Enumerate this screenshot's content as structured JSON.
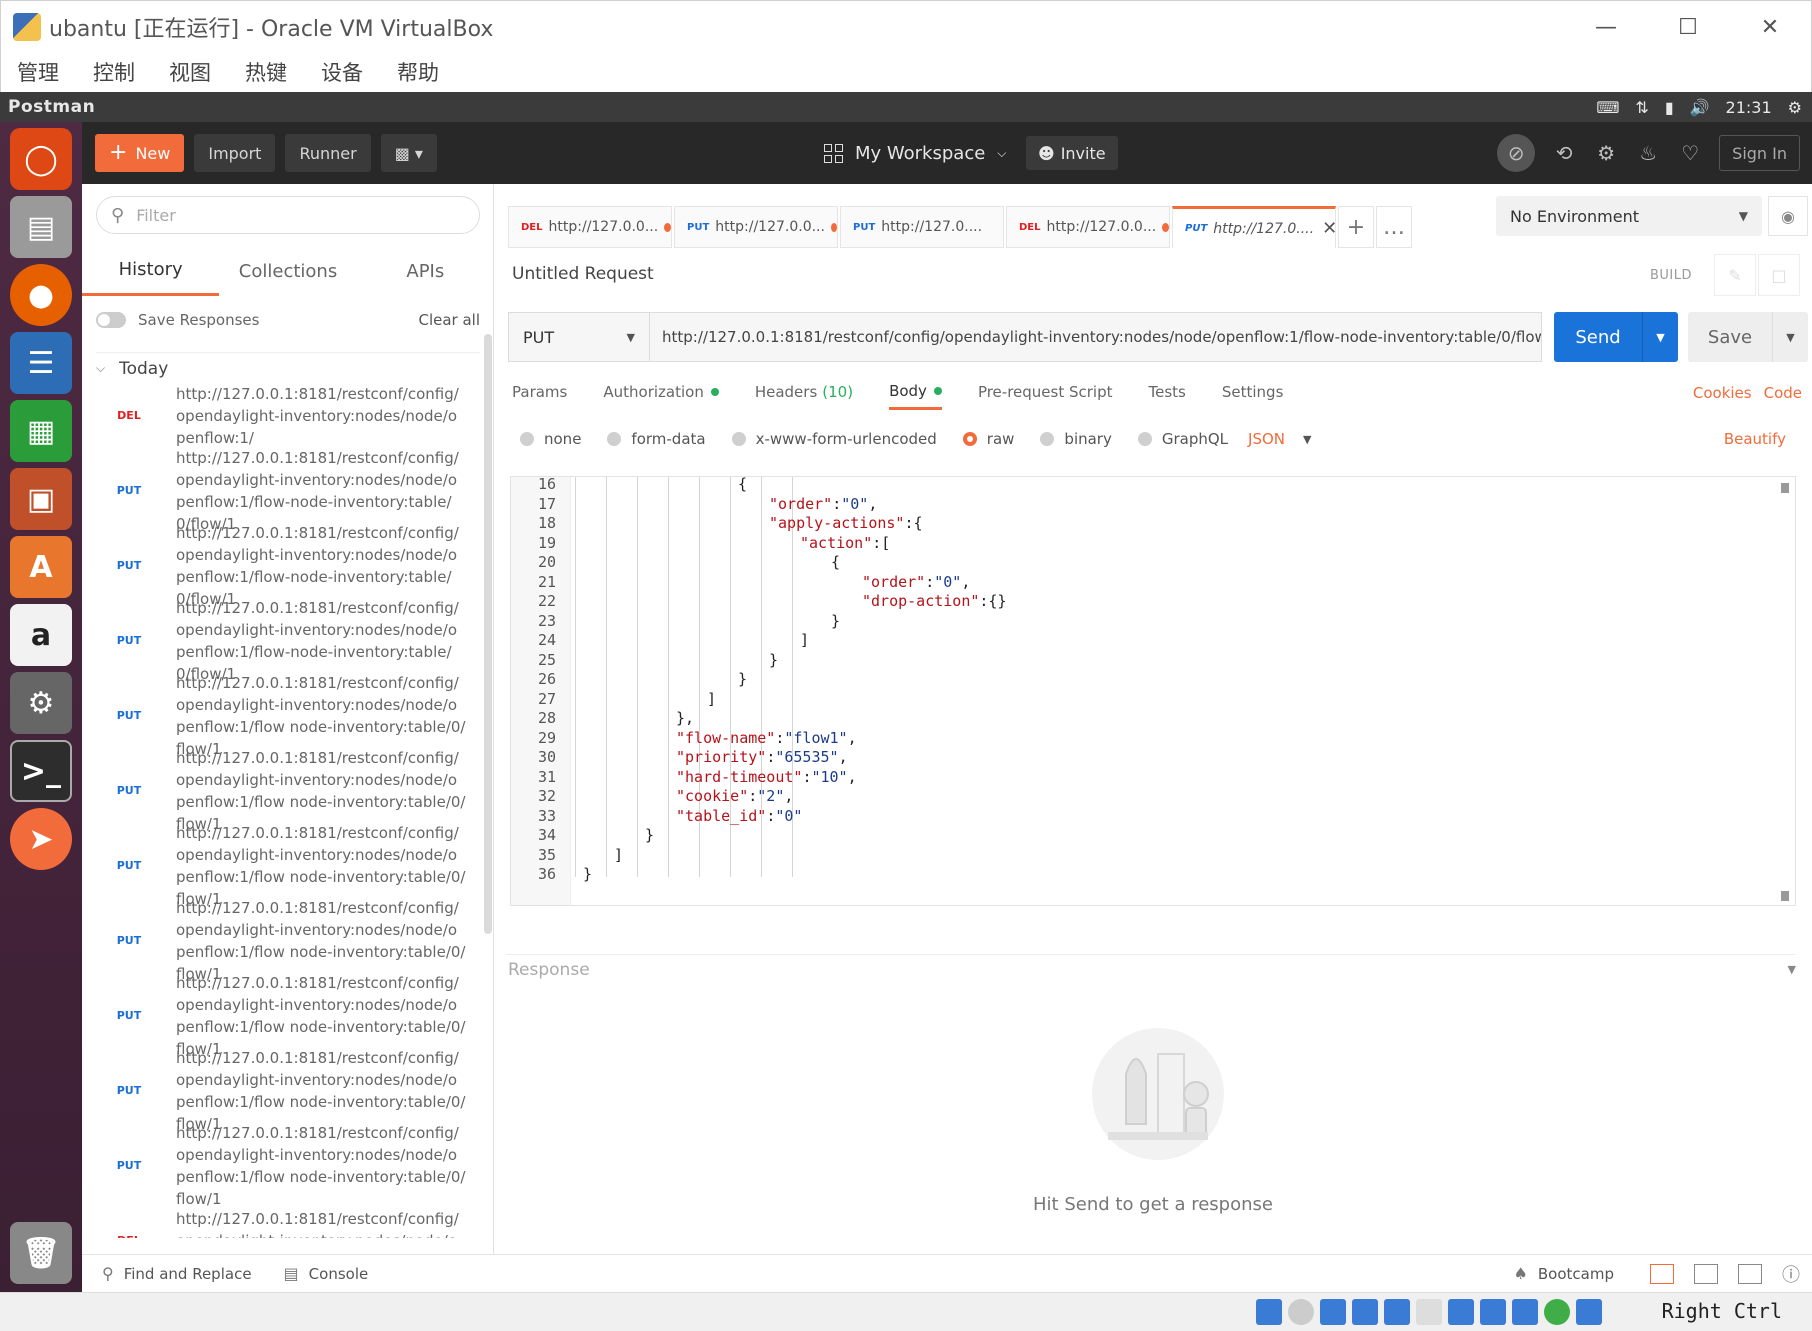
{
  "vbox": {
    "title": "ubantu [正在运行] - Oracle VM VirtualBox",
    "menu": [
      "管理",
      "控制",
      "视图",
      "热键",
      "设备",
      "帮助"
    ],
    "host_key": "Right Ctrl"
  },
  "ubuntu": {
    "app_name": "Postman",
    "clock": "21:31"
  },
  "header": {
    "new_label": "New",
    "import_label": "Import",
    "runner_label": "Runner",
    "workspace_label": "My Workspace",
    "invite_label": "Invite",
    "signin_label": "Sign In"
  },
  "sidebar": {
    "filter_placeholder": "Filter",
    "tabs": [
      "History",
      "Collections",
      "APIs"
    ],
    "save_responses_label": "Save Responses",
    "clear_all_label": "Clear all",
    "group_label": "Today",
    "history": [
      {
        "method": "DEL",
        "url": "http://127.0.0.1:8181/restconf/config/opendaylight-inventory:nodes/node/openflow:1/"
      },
      {
        "method": "PUT",
        "url": "http://127.0.0.1:8181/restconf/config/opendaylight-inventory:nodes/node/openflow:1/flow-node-inventory:table/0/flow/1"
      },
      {
        "method": "PUT",
        "url": "http://127.0.0.1:8181/restconf/config/opendaylight-inventory:nodes/node/openflow:1/flow-node-inventory:table/0/flow/1"
      },
      {
        "method": "PUT",
        "url": "http://127.0.0.1:8181/restconf/config/opendaylight-inventory:nodes/node/openflow:1/flow-node-inventory:table/0/flow/1"
      },
      {
        "method": "PUT",
        "url": "http://127.0.0.1:8181/restconf/config/opendaylight-inventory:nodes/node/openflow:1/flow node-inventory:table/0/flow/1"
      },
      {
        "method": "PUT",
        "url": "http://127.0.0.1:8181/restconf/config/opendaylight-inventory:nodes/node/openflow:1/flow node-inventory:table/0/flow/1"
      },
      {
        "method": "PUT",
        "url": "http://127.0.0.1:8181/restconf/config/opendaylight-inventory:nodes/node/openflow:1/flow node-inventory:table/0/flow/1"
      },
      {
        "method": "PUT",
        "url": "http://127.0.0.1:8181/restconf/config/opendaylight-inventory:nodes/node/openflow:1/flow node-inventory:table/0/flow/1"
      },
      {
        "method": "PUT",
        "url": "http://127.0.0.1:8181/restconf/config/opendaylight-inventory:nodes/node/openflow:1/flow node-inventory:table/0/flow/1"
      },
      {
        "method": "PUT",
        "url": "http://127.0.0.1:8181/restconf/config/opendaylight-inventory:nodes/node/openflow:1/flow node-inventory:table/0/flow/1"
      },
      {
        "method": "PUT",
        "url": "http://127.0.0.1:8181/restconf/config/opendaylight-inventory:nodes/node/openflow:1/flow node-inventory:table/0/flow/1"
      },
      {
        "method": "DEL",
        "url": "http://127.0.0.1:8181/restconf/config/opendaylight-inventory:nodes/node/openflo"
      }
    ]
  },
  "request_tabs": [
    {
      "method": "DEL",
      "label": "http://127.0.0...",
      "unsaved": true
    },
    {
      "method": "PUT",
      "label": "http://127.0.0...",
      "unsaved": true
    },
    {
      "method": "PUT",
      "label": "http://127.0....",
      "unsaved": false
    },
    {
      "method": "DEL",
      "label": "http://127.0.0...",
      "unsaved": true
    },
    {
      "method": "PUT",
      "label": "http://127.0....",
      "unsaved": false,
      "active": true
    }
  ],
  "environment": {
    "selected": "No Environment"
  },
  "request": {
    "name": "Untitled Request",
    "build_label": "BUILD",
    "method": "PUT",
    "url": "http://127.0.0.1:8181/restconf/config/opendaylight-inventory:nodes/node/openflow:1/flow-node-inventory:table/0/flow/1",
    "send_label": "Send",
    "save_label": "Save"
  },
  "sub_tabs": {
    "params": "Params",
    "authorization": "Authorization",
    "headers": "Headers",
    "headers_count": "(10)",
    "body": "Body",
    "pre_request": "Pre-request Script",
    "tests": "Tests",
    "settings": "Settings",
    "cookies": "Cookies",
    "code": "Code"
  },
  "body_types": {
    "options": [
      "none",
      "form-data",
      "x-www-form-urlencoded",
      "raw",
      "binary",
      "GraphQL"
    ],
    "selected": "raw",
    "format": "JSON",
    "beautify": "Beautify"
  },
  "code_lines": [
    {
      "n": "16",
      "indent": 5,
      "text": "{"
    },
    {
      "n": "17",
      "indent": 6,
      "text": "\"order\":\"0\","
    },
    {
      "n": "18",
      "indent": 6,
      "text": "\"apply-actions\":{"
    },
    {
      "n": "19",
      "indent": 7,
      "text": "\"action\":["
    },
    {
      "n": "20",
      "indent": 8,
      "text": "{"
    },
    {
      "n": "21",
      "indent": 9,
      "text": "\"order\":\"0\","
    },
    {
      "n": "22",
      "indent": 9,
      "text": "\"drop-action\":{}"
    },
    {
      "n": "23",
      "indent": 8,
      "text": "}"
    },
    {
      "n": "24",
      "indent": 7,
      "text": "]"
    },
    {
      "n": "25",
      "indent": 6,
      "text": "}"
    },
    {
      "n": "26",
      "indent": 5,
      "text": "}"
    },
    {
      "n": "27",
      "indent": 4,
      "text": "]"
    },
    {
      "n": "28",
      "indent": 3,
      "text": "},"
    },
    {
      "n": "29",
      "indent": 3,
      "text": "\"flow-name\":\"flow1\","
    },
    {
      "n": "30",
      "indent": 3,
      "text": "\"priority\":\"65535\","
    },
    {
      "n": "31",
      "indent": 3,
      "text": "\"hard-timeout\":\"10\","
    },
    {
      "n": "32",
      "indent": 3,
      "text": "\"cookie\":\"2\","
    },
    {
      "n": "33",
      "indent": 3,
      "text": "\"table_id\":\"0\""
    },
    {
      "n": "34",
      "indent": 2,
      "text": "}"
    },
    {
      "n": "35",
      "indent": 1,
      "text": "]"
    },
    {
      "n": "36",
      "indent": 0,
      "text": "}"
    }
  ],
  "response": {
    "label": "Response",
    "empty_text": "Hit Send to get a response"
  },
  "statusbar": {
    "find_replace": "Find and Replace",
    "console": "Console",
    "bootcamp": "Bootcamp"
  },
  "colors": {
    "accent": "#f26b3a",
    "send_blue": "#1a73d8",
    "header_bg": "#282828"
  }
}
